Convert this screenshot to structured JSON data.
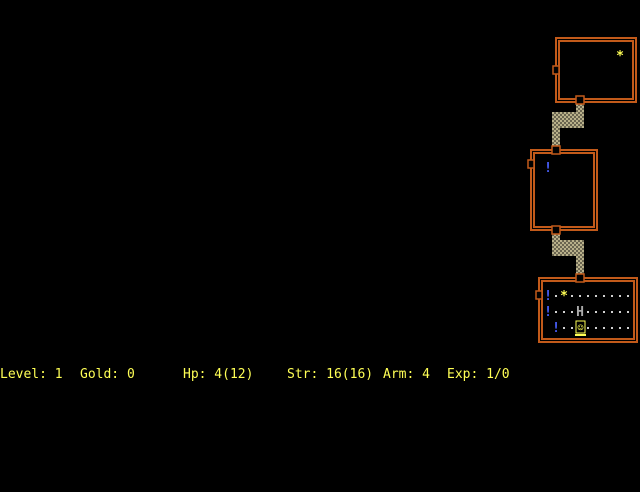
{
  "colors": {
    "wall": "#c25a1a",
    "corridor": "#b8b08a",
    "gold": "#ffff55",
    "potion": "#4a60ff",
    "floor_dot": "#d0d0d0",
    "monster": "#aaaaaa",
    "player_fg": "#ffff55",
    "status_text": "#ffff55"
  },
  "map": {
    "rooms": [
      {
        "name": "room-top",
        "contents": [
          {
            "type": "gold",
            "glyph": "*"
          }
        ]
      },
      {
        "name": "room-middle",
        "contents": [
          {
            "type": "potion",
            "glyph": "!"
          }
        ]
      },
      {
        "name": "room-bottom",
        "contents": [
          {
            "type": "potion",
            "glyph": "!"
          },
          {
            "type": "gold",
            "glyph": "*"
          },
          {
            "type": "potion",
            "glyph": "!"
          },
          {
            "type": "monster",
            "glyph": "H"
          },
          {
            "type": "potion",
            "glyph": "!"
          },
          {
            "type": "player",
            "glyph": "☺"
          }
        ]
      }
    ]
  },
  "status": {
    "level": "Level: 1",
    "gold": "Gold: 0",
    "hp": "Hp: 4(12)",
    "str": "Str: 16(16)",
    "arm": "Arm: 4",
    "exp": "Exp: 1/0"
  }
}
